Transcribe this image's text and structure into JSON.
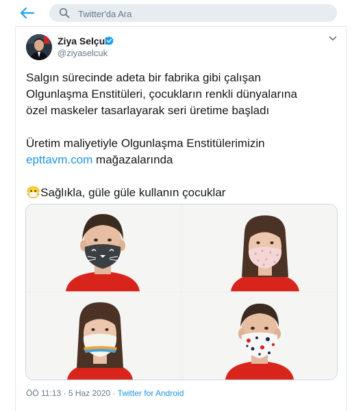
{
  "search": {
    "placeholder": "Twitter'da Ara"
  },
  "user": {
    "name": "Ziya Selçuk",
    "handle": "@ziyaselcuk",
    "verified": true
  },
  "tweet": {
    "line1": "Salgın sürecinde adeta bir fabrika gibi çalışan",
    "line2": "Olgunlaşma Enstitüleri, çocukların renkli dünyalarına",
    "line3": "özel maskeler tasarlayarak seri üretime başladı",
    "line4": "Üretim maliyetiyle Olgunlaşma Enstitülerimizin",
    "link": "epttavm.com",
    "line5_rest": " mağazalarında",
    "emoji": "😷",
    "line6": "Sağlıkla, güle güle kullanın çocuklar"
  },
  "meta": {
    "time": "ÖÖ 11:13",
    "sep": " · ",
    "date": "5 Haz 2020",
    "sep2": " · ",
    "source": "Twitter for Android"
  },
  "colors": {
    "link": "#1b95e0",
    "verified": "#1da1f2",
    "secondary": "#657786",
    "shirt": "#d9241c"
  },
  "icons": [
    "back-arrow-icon",
    "search-icon",
    "verified-badge-icon",
    "chevron-down-icon"
  ]
}
